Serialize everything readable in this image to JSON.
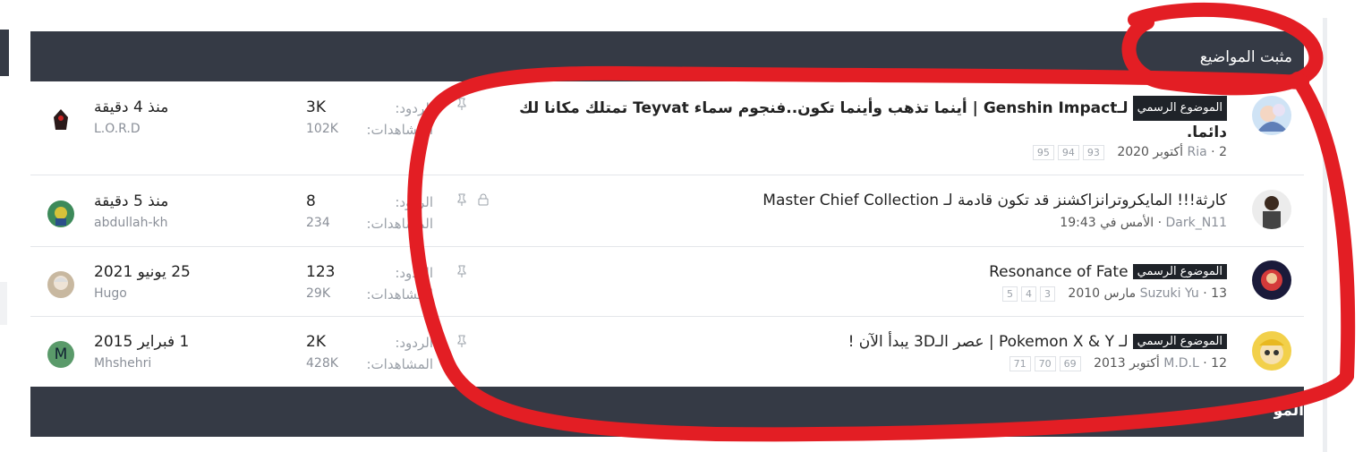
{
  "section": {
    "title": "مثبت المواضيع",
    "next_section_title": "المو"
  },
  "labels": {
    "replies": "الردود:",
    "views": "المشاهدات:",
    "official_badge": "الموضوع الرسمي"
  },
  "threads": [
    {
      "title": "لـGenshin Impact | أينما تذهب وأينما تكون..فنجوم سماء Teyvat تمتلك مكانا لك دائما.",
      "official": true,
      "author": "Ria",
      "date": "2 أكتوبر 2020",
      "pages": [
        "93",
        "94",
        "95"
      ],
      "replies": "3K",
      "views": "102K",
      "last_time": "منذ 4 دقيقة",
      "last_user": "L.O.R.D",
      "locked": false
    },
    {
      "title": "كارثة!!! المايكروترانزاكشنز قد تكون قادمة لـ Master Chief Collection",
      "official": false,
      "author": "Dark_N11",
      "date": "الأمس في 19:43",
      "pages": [],
      "replies": "8",
      "views": "234",
      "last_time": "منذ 5 دقيقة",
      "last_user": "abdullah-kh",
      "locked": true
    },
    {
      "title": "Resonance of Fate",
      "official": true,
      "author": "Suzuki Yu",
      "date": "13 مارس 2010",
      "pages": [
        "3",
        "4",
        "5"
      ],
      "replies": "123",
      "views": "29K",
      "last_time": "25 يونيو 2021",
      "last_user": "Hugo",
      "locked": false
    },
    {
      "title": "لـ Pokemon X & Y | عصر الـ3D يبدأ الآن !",
      "official": true,
      "author": "M.D.L",
      "date": "12 أكتوبر 2013",
      "pages": [
        "69",
        "70",
        "71"
      ],
      "replies": "2K",
      "views": "428K",
      "last_time": "1 فبراير 2015",
      "last_user": "Mhshehri",
      "last_avatar_letter": "M",
      "locked": false
    }
  ],
  "icons": {
    "pin": "pin-icon",
    "lock": "lock-icon"
  },
  "colors": {
    "header_bg": "#353a45",
    "badge_bg": "#1f2329",
    "annotation": "#e31e24"
  }
}
